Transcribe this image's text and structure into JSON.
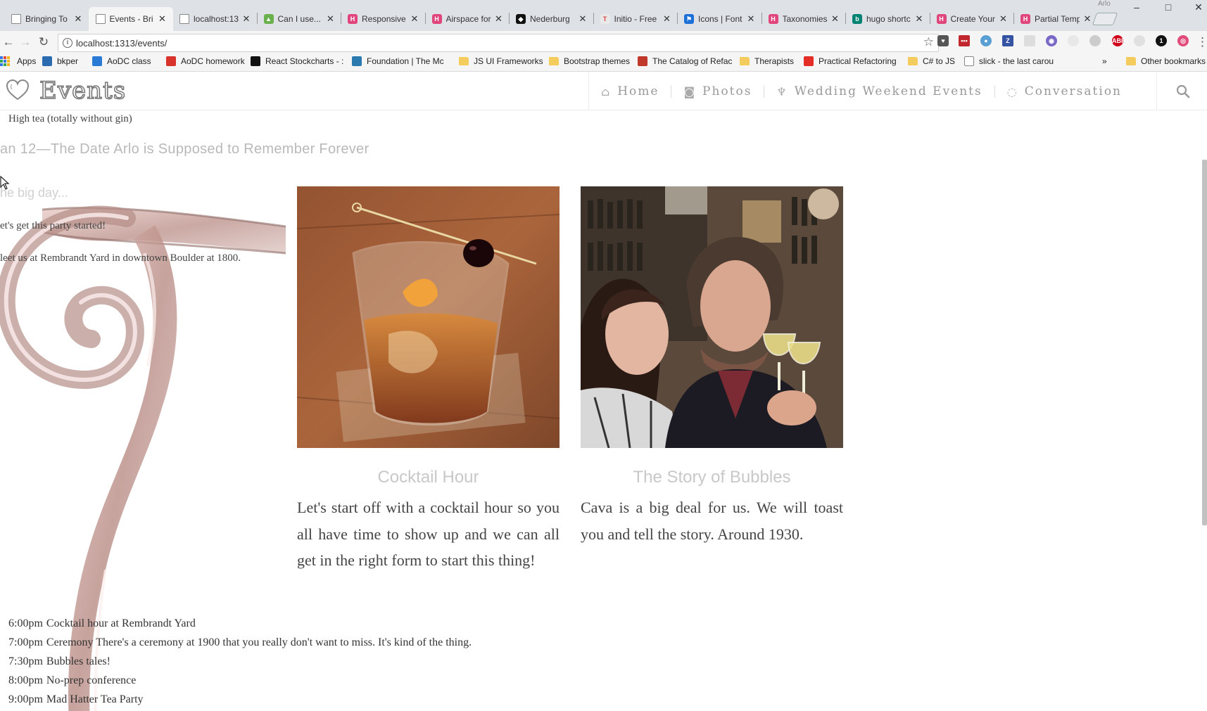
{
  "browser": {
    "profile_name": "Arlo",
    "tabs": [
      {
        "title": "Bringing To",
        "favicon": "doc",
        "active": false
      },
      {
        "title": "Events - Bri",
        "favicon": "doc",
        "active": true
      },
      {
        "title": "localhost:13",
        "favicon": "doc",
        "active": false
      },
      {
        "title": "Can I use...",
        "favicon": "caniuse",
        "active": false
      },
      {
        "title": "Responsive",
        "favicon": "hugo",
        "active": false
      },
      {
        "title": "Airspace for",
        "favicon": "hugo",
        "active": false
      },
      {
        "title": "Nederburg",
        "favicon": "nederburg",
        "active": false
      },
      {
        "title": "Initio - Free",
        "favicon": "initio",
        "active": false
      },
      {
        "title": "Icons | Font",
        "favicon": "fontawesome",
        "active": false
      },
      {
        "title": "Taxonomies",
        "favicon": "hugo",
        "active": false
      },
      {
        "title": "hugo shortc",
        "favicon": "bing",
        "active": false
      },
      {
        "title": "Create Your",
        "favicon": "hugo",
        "active": false
      },
      {
        "title": "Partial Temp",
        "favicon": "hugo",
        "active": false
      }
    ],
    "url": "localhost:1313/events/",
    "bookmarks": [
      {
        "label": "Apps",
        "icon": "apps-grid"
      },
      {
        "label": "bkper",
        "icon": "bkper"
      },
      {
        "label": "AoDC class",
        "icon": "aodc-class"
      },
      {
        "label": "AoDC homework",
        "icon": "aodc-homework"
      },
      {
        "label": "React Stockcharts - :",
        "icon": "stockcharts"
      },
      {
        "label": "Foundation | The Mc",
        "icon": "foundation"
      },
      {
        "label": "JS UI Frameworks",
        "icon": "folder"
      },
      {
        "label": "Bootstrap themes",
        "icon": "folder"
      },
      {
        "label": "The Catalog of Refac",
        "icon": "refactoring"
      },
      {
        "label": "Therapists",
        "icon": "folder"
      },
      {
        "label": "Practical Refactoring",
        "icon": "youtube"
      },
      {
        "label": "C# to JS",
        "icon": "folder"
      },
      {
        "label": "slick - the last carou",
        "icon": "doc"
      },
      {
        "label": "»",
        "icon": "none"
      },
      {
        "label": "Other bookmarks",
        "icon": "folder"
      }
    ],
    "colors": {
      "tabstrip": "#dee1e6",
      "toolbar": "#f5f5f5",
      "accent": "#3578e5"
    }
  },
  "site": {
    "brand_title": "Events",
    "nav": [
      {
        "label": "Home",
        "icon": "home-icon",
        "glyph": "⌂"
      },
      {
        "label": "Photos",
        "icon": "camera-icon",
        "glyph": "◙"
      },
      {
        "label": "Wedding Weekend Events",
        "icon": "glass-icon",
        "glyph": "♆"
      },
      {
        "label": "Conversation",
        "icon": "comments-icon",
        "glyph": "◌"
      }
    ]
  },
  "content": {
    "previous_item": "High tea (totally without gin)",
    "section_heading": "an 12—The Date Arlo is Supposed to Remember Forever",
    "hero": {
      "subtitle": "he big day...",
      "line1": "et's get this party started!",
      "line2": "leet us at Rembrandt Yard in downtown Boulder at 1800."
    },
    "cards": [
      {
        "title": "Cocktail Hour",
        "body": "Let's start off with a cocktail hour so you all have time to show up and we can all get in the right form to start this thing!"
      },
      {
        "title": "The Story of Bubbles",
        "body": "Cava is a big deal for us. We will toast you and tell the story. Around 1930."
      }
    ],
    "schedule": [
      {
        "time": "6:00pm",
        "text": "Cocktail hour at Rembrandt Yard"
      },
      {
        "time": "7:00pm",
        "text": "Ceremony There's a ceremony at 1900 that you really don't want to miss. It's kind of the thing."
      },
      {
        "time": "7:30pm",
        "text": "Bubbles tales!"
      },
      {
        "time": "8:00pm",
        "text": "No-prep conference"
      },
      {
        "time": "9:00pm",
        "text": "Mad Hatter Tea Party"
      }
    ]
  }
}
